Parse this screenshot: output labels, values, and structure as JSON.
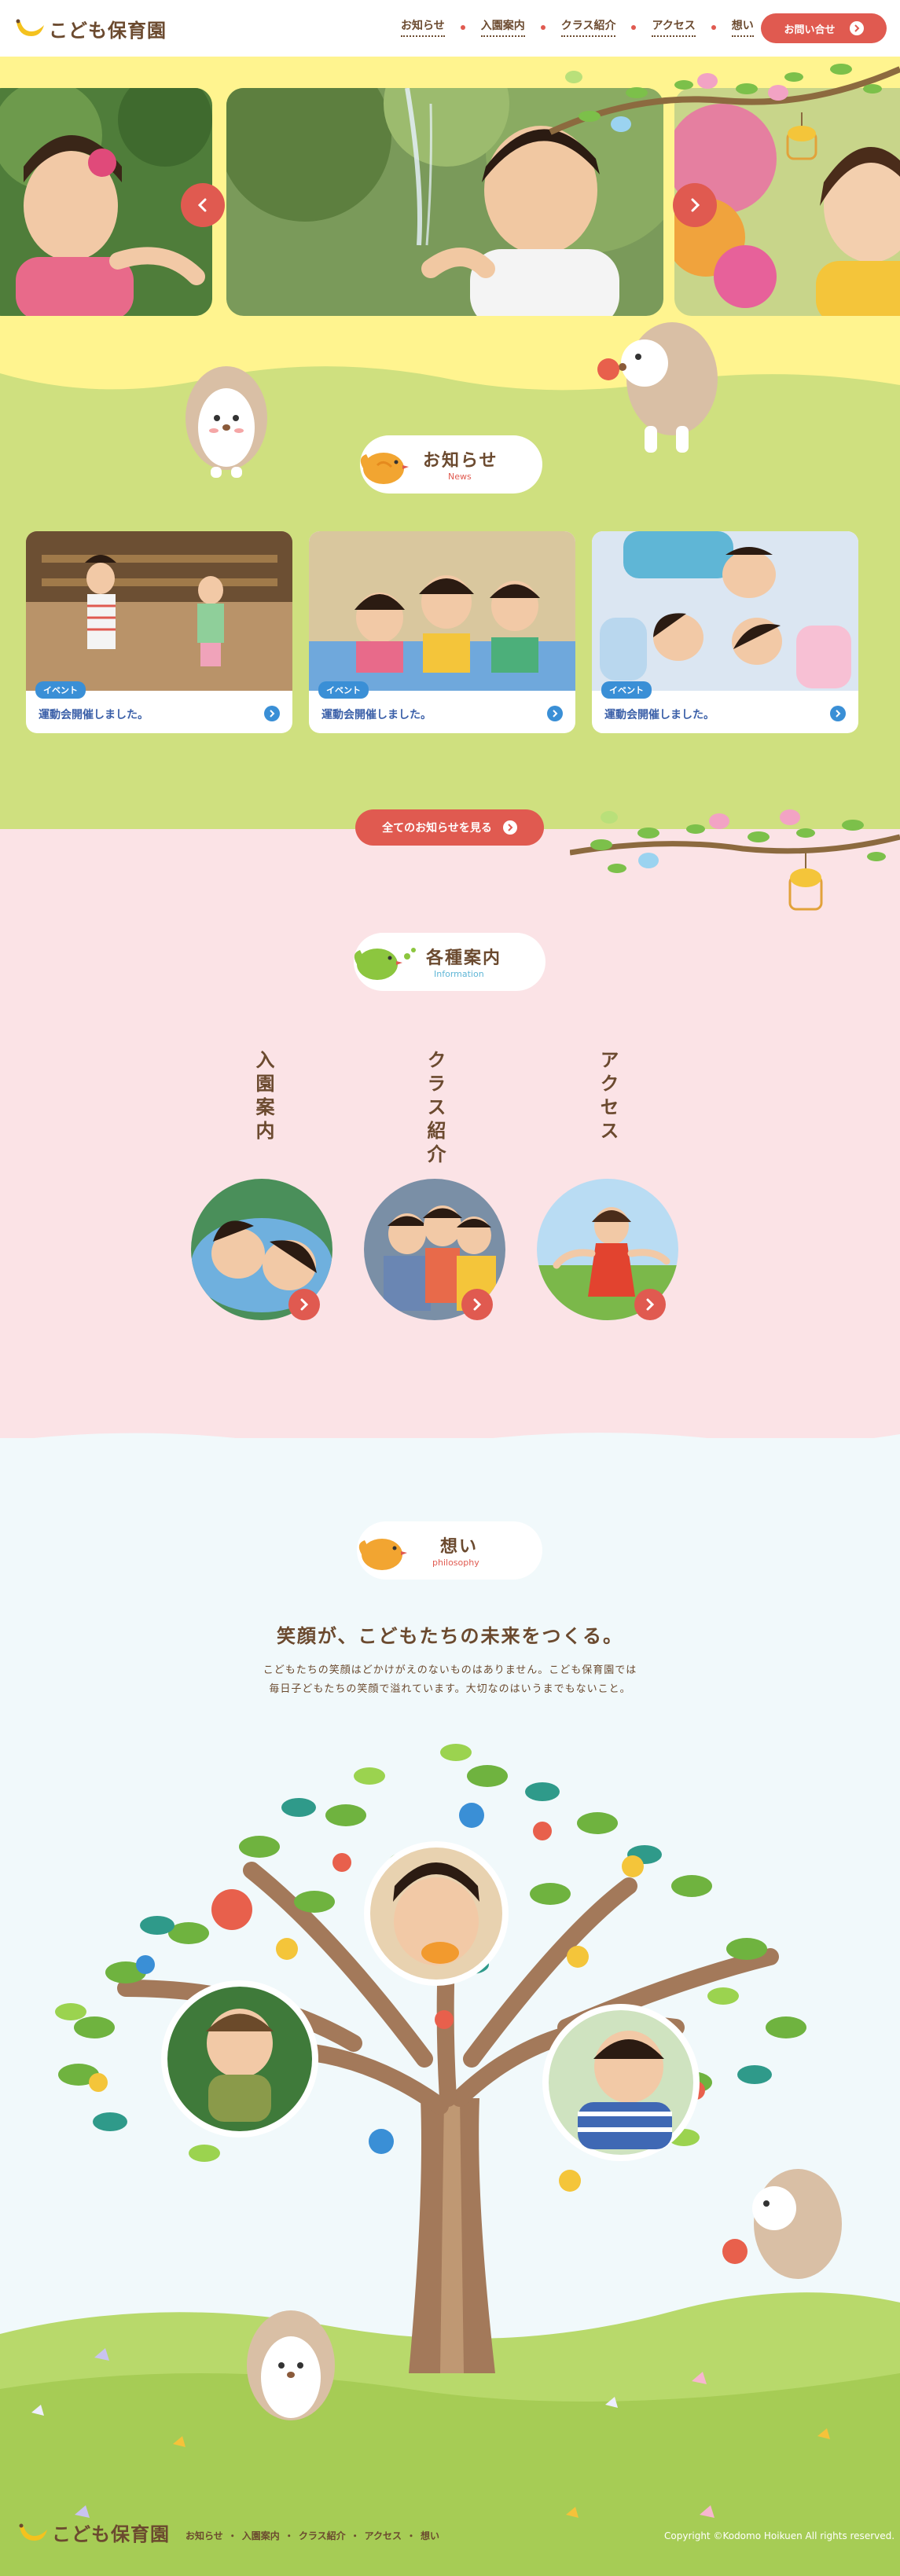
{
  "header": {
    "logo_text": "こども保育園",
    "nav": [
      "お知らせ",
      "入園案内",
      "クラス紹介",
      "アクセス",
      "想い"
    ],
    "contact_label": "お問い合せ"
  },
  "news": {
    "heading_jp": "お知らせ",
    "heading_en": "News",
    "cards": [
      {
        "tag": "イベント",
        "title": "運動会開催しました。"
      },
      {
        "tag": "イベント",
        "title": "運動会開催しました。"
      },
      {
        "tag": "イベント",
        "title": "運動会開催しました。"
      }
    ],
    "all_label": "全てのお知らせを見る"
  },
  "info": {
    "heading_jp": "各種案内",
    "heading_en": "Information",
    "items": [
      "入園案内",
      "クラス紹介",
      "アクセス"
    ]
  },
  "philosophy": {
    "heading_jp": "想い",
    "heading_en": "philosophy",
    "catch": "笑顔が、こどもたちの未来をつくる。",
    "lead_1": "こどもたちの笑顔はどかけがえのないものはありません。こども保育園では",
    "lead_2": "毎日子どもたちの笑顔で溢れています。大切なのはいうまでもないこと。"
  },
  "footer": {
    "logo_text": "こども保育園",
    "nav": [
      "お知らせ",
      "入園案内",
      "クラス紹介",
      "アクセス",
      "想い"
    ],
    "copyright": "Copyright ©Kodomo Hoikuen All rights reserved."
  },
  "colors": {
    "accent": "#e05a50",
    "brown": "#6b4a2f",
    "news_bg": "#cfe07f",
    "hero_bg": "#fff48f",
    "info_bg": "#fbe3e6",
    "philosophy_bg": "#f1f9fb",
    "tag_blue": "#3a8fd6"
  }
}
